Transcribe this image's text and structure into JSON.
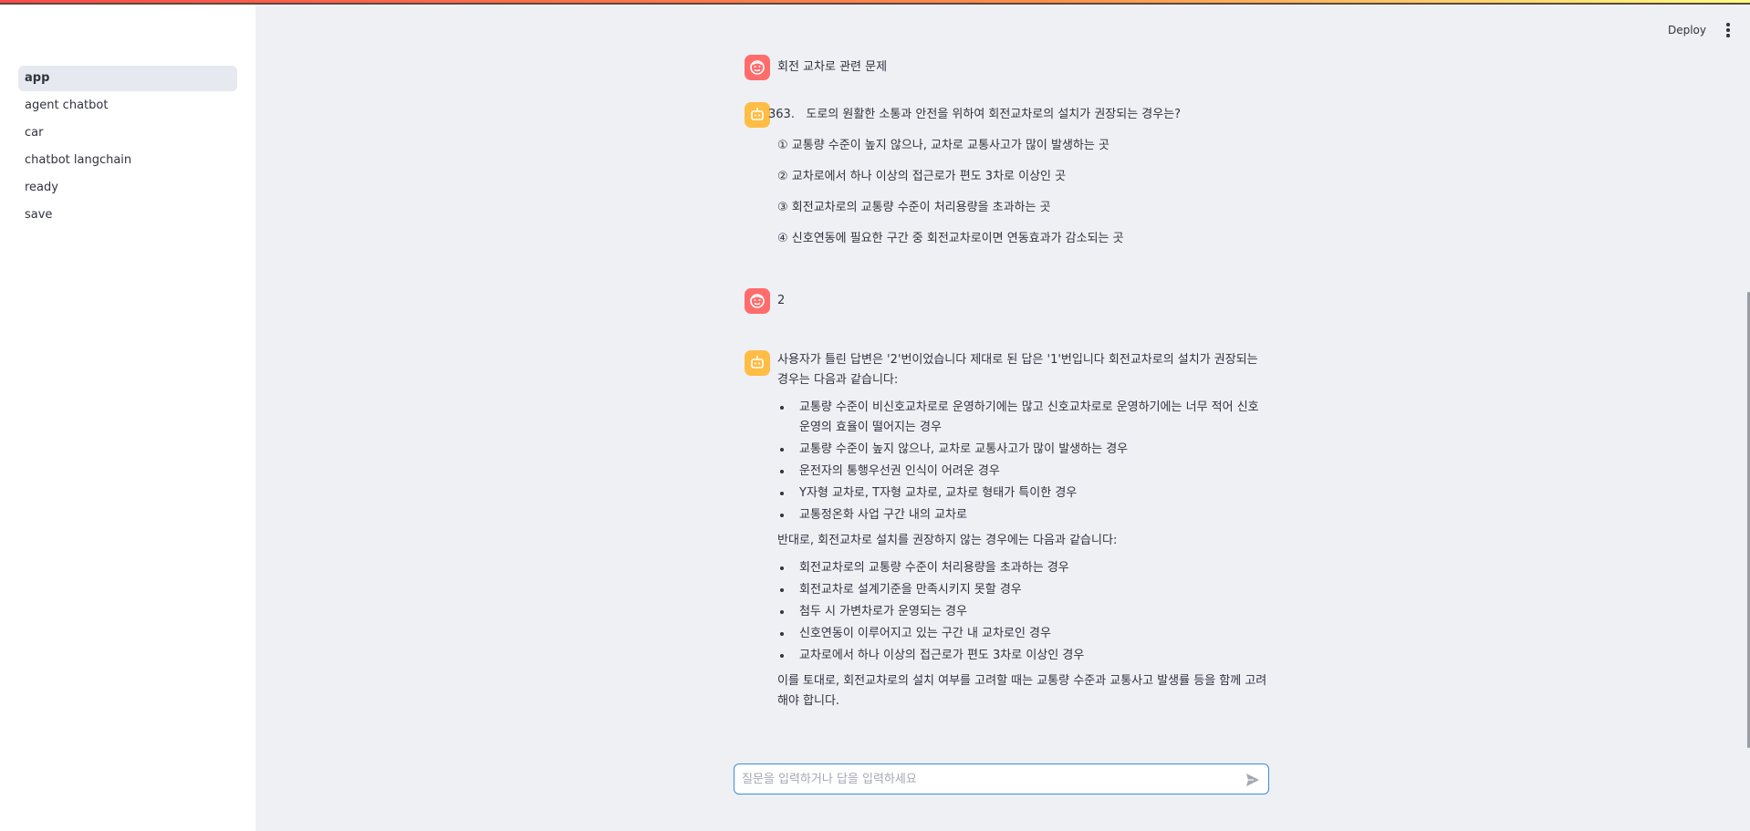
{
  "sidebar": {
    "items": [
      {
        "label": "app",
        "active": true
      },
      {
        "label": "agent chatbot"
      },
      {
        "label": "car"
      },
      {
        "label": "chatbot langchain"
      },
      {
        "label": "ready"
      },
      {
        "label": "save"
      }
    ]
  },
  "header": {
    "deploy_label": "Deploy",
    "menu_icon": "kebab-menu-icon"
  },
  "chat": {
    "messages": [
      {
        "role": "user",
        "text": "회전 교차로 관련 문제"
      },
      {
        "role": "assistant",
        "question_number": "363.",
        "question": "도로의 원활한 소통과 안전을 위하여 회전교차로의 설치가 권장되는 경우는?",
        "options": [
          "① 교통량 수준이 높지 않으나, 교차로 교통사고가 많이 발생하는 곳",
          "② 교차로에서 하나 이상의 접근로가 편도 3차로 이상인 곳",
          "③ 회전교차로의 교통량 수준이 처리용량을 초과하는 곳",
          "④ 신호연동에 필요한 구간 중 회전교차로이면 연동효과가 감소되는 곳"
        ]
      },
      {
        "role": "user",
        "text": "2"
      },
      {
        "role": "assistant",
        "intro": "사용자가 틀린 답변은 '2'번이었습니다 제대로 된 답은 '1'번입니다 회전교차로의 설치가 권장되는 경우는 다음과 같습니다:",
        "recommended": [
          "교통량 수준이 비신호교차로로 운영하기에는 많고 신호교차로로 운영하기에는 너무 적어 신호운영의 효율이 떨어지는 경우",
          "교통량 수준이 높지 않으나, 교차로 교통사고가 많이 발생하는 경우",
          "운전자의 통행우선권 인식이 어려운 경우",
          "Y자형 교차로, T자형 교차로, 교차로 형태가 특이한 경우",
          "교통정온화 사업 구간 내의 교차로"
        ],
        "middle": "반대로, 회전교차로 설치를 권장하지 않는 경우에는 다음과 같습니다:",
        "not_recommended": [
          "회전교차로의 교통량 수준이 처리용량을 초과하는 경우",
          "회전교차로 설계기준을 만족시키지 못할 경우",
          "첨두 시 가변차로가 운영되는 경우",
          "신호연동이 이루어지고 있는 구간 내 교차로인 경우",
          "교차로에서 하나 이상의 접근로가 편도 3차로 이상인 경우"
        ],
        "conclusion": "이를 토대로, 회전교차로의 설치 여부를 고려할 때는 교통량 수준과 교통사고 발생률 등을 함께 고려해야 합니다."
      }
    ]
  },
  "input": {
    "placeholder": "질문을 입력하거나 답을 입력하세요",
    "value": ""
  },
  "colors": {
    "user_avatar": "#ff6c6c",
    "assistant_avatar": "#ffbd45",
    "input_border": "#3a8fd6",
    "main_bg": "#eef0f4"
  }
}
